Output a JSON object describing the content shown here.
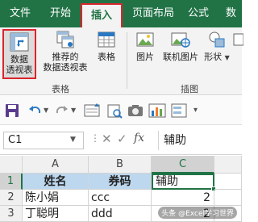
{
  "tabs": [
    "文件",
    "开始",
    "插入",
    "页面布局",
    "公式",
    "数"
  ],
  "active_tab": "插入",
  "ribbon": {
    "pivot_table": [
      "数据",
      "透视表"
    ],
    "recommended_pivot": [
      "推荐的",
      "数据透视表"
    ],
    "table": "表格",
    "tables_group": "表格",
    "picture": "图片",
    "online_picture": "联机图片",
    "shapes": "形状",
    "illustrations_group": "插图"
  },
  "name_box": "C1",
  "formula_value": "辅助",
  "columns": [
    "A",
    "B",
    "C"
  ],
  "rows": [
    {
      "num": "1",
      "a": "姓名",
      "b": "券码",
      "c": "辅助"
    },
    {
      "num": "2",
      "a": "陈小娟",
      "b": "ccc",
      "c": "2"
    },
    {
      "num": "3",
      "a": "丁聪明",
      "b": "ddd",
      "c": "2"
    }
  ],
  "watermark": "头条 @Excel学习世界",
  "colors": {
    "excel_green": "#217346",
    "highlight_red": "#d9262c",
    "header_blue": "#bdd7ee"
  }
}
